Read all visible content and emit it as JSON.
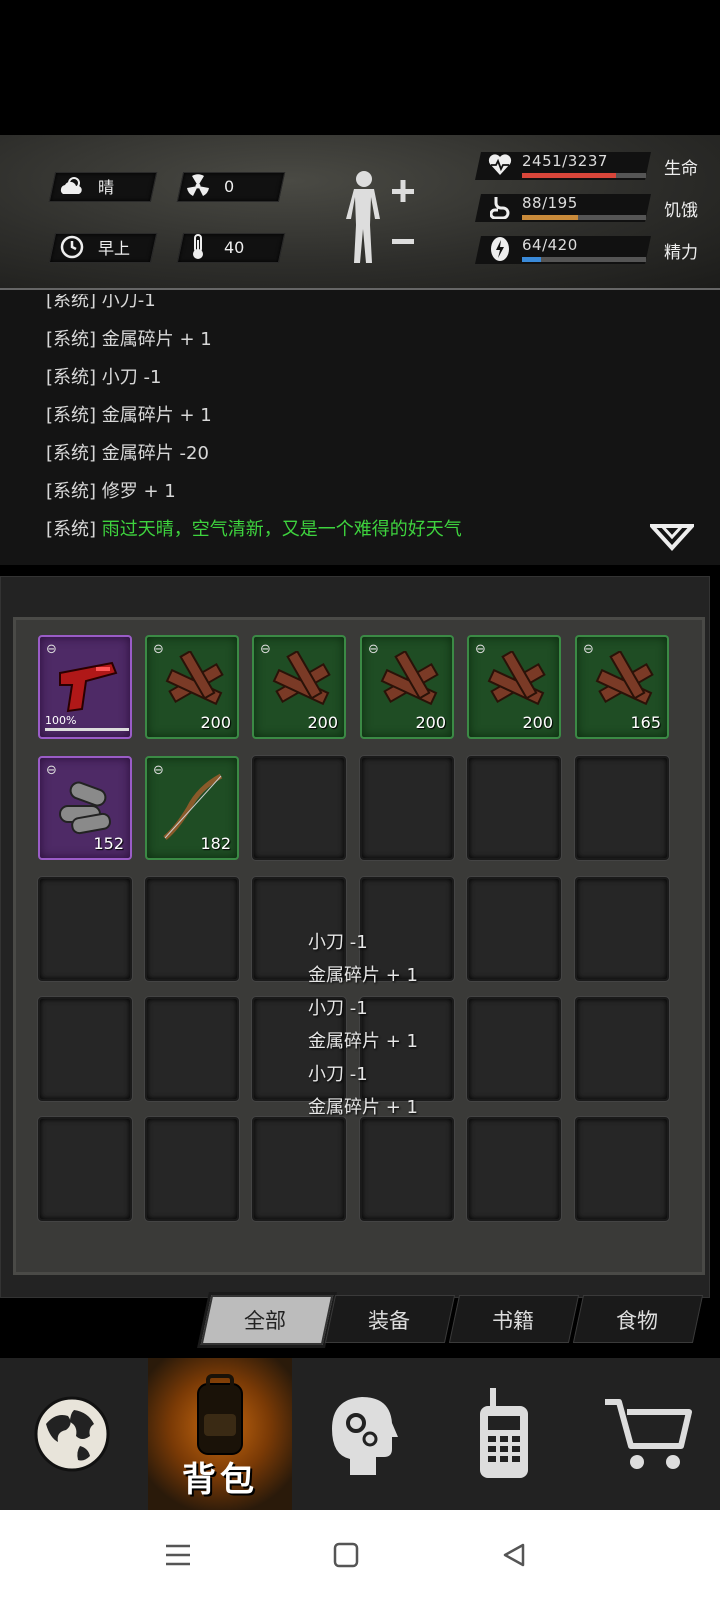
{
  "status": {
    "weather": {
      "icon": "cloud-sun-icon",
      "label": "晴"
    },
    "radiation": {
      "icon": "radiation-icon",
      "value": "0"
    },
    "time": {
      "icon": "clock-icon",
      "label": "早上"
    },
    "temperature": {
      "icon": "thermometer-icon",
      "value": "40"
    },
    "stats": [
      {
        "icon": "heart-pulse-icon",
        "value": "2451/3237",
        "name": "生命",
        "fraction": 0.757,
        "color": "#d9463a"
      },
      {
        "icon": "stomach-icon",
        "value": "88/195",
        "name": "饥饿",
        "fraction": 0.451,
        "color": "#c98a3a"
      },
      {
        "icon": "energy-icon",
        "value": "64/420",
        "name": "精力",
        "fraction": 0.152,
        "color": "#3a8ad9"
      }
    ]
  },
  "log": {
    "partial_top": "[系统] 小刀-1",
    "lines": [
      {
        "prefix": "[系统]",
        "text": "金属碎片 + 1",
        "highlight": false
      },
      {
        "prefix": "[系统]",
        "text": "小刀 -1",
        "highlight": false
      },
      {
        "prefix": "[系统]",
        "text": "金属碎片 + 1",
        "highlight": false
      },
      {
        "prefix": "[系统]",
        "text": "金属碎片 -20",
        "highlight": false
      },
      {
        "prefix": "[系统]",
        "text": "修罗 + 1",
        "highlight": false
      },
      {
        "prefix": "[系统]",
        "text": "雨过天晴，空气清新，又是一个难得的好天气",
        "highlight": true
      }
    ]
  },
  "inventory": {
    "items": [
      {
        "name": "red-pistol",
        "rarity": "purple",
        "durability": "100%",
        "quantity": ""
      },
      {
        "name": "wood-planks",
        "rarity": "green",
        "quantity": "200"
      },
      {
        "name": "wood-planks",
        "rarity": "green",
        "quantity": "200"
      },
      {
        "name": "wood-planks",
        "rarity": "green",
        "quantity": "200"
      },
      {
        "name": "wood-planks",
        "rarity": "green",
        "quantity": "200"
      },
      {
        "name": "wood-planks",
        "rarity": "green",
        "quantity": "165"
      },
      {
        "name": "bullets",
        "rarity": "purple",
        "quantity": "152"
      },
      {
        "name": "wooden-bow",
        "rarity": "green",
        "quantity": "182"
      }
    ],
    "float_messages": [
      "小刀 -1",
      "金属碎片 + 1",
      "小刀 -1",
      "金属碎片 + 1",
      "小刀 -1",
      "金属碎片 + 1"
    ]
  },
  "tabs": [
    {
      "label": "全部",
      "active": true
    },
    {
      "label": "装备",
      "active": false
    },
    {
      "label": "书籍",
      "active": false
    },
    {
      "label": "食物",
      "active": false
    }
  ],
  "nav": {
    "items": [
      {
        "icon": "globe-icon"
      },
      {
        "icon": "backpack-icon",
        "label": "背包",
        "active": true
      },
      {
        "icon": "head-gears-icon"
      },
      {
        "icon": "radio-icon"
      },
      {
        "icon": "cart-icon"
      }
    ]
  }
}
